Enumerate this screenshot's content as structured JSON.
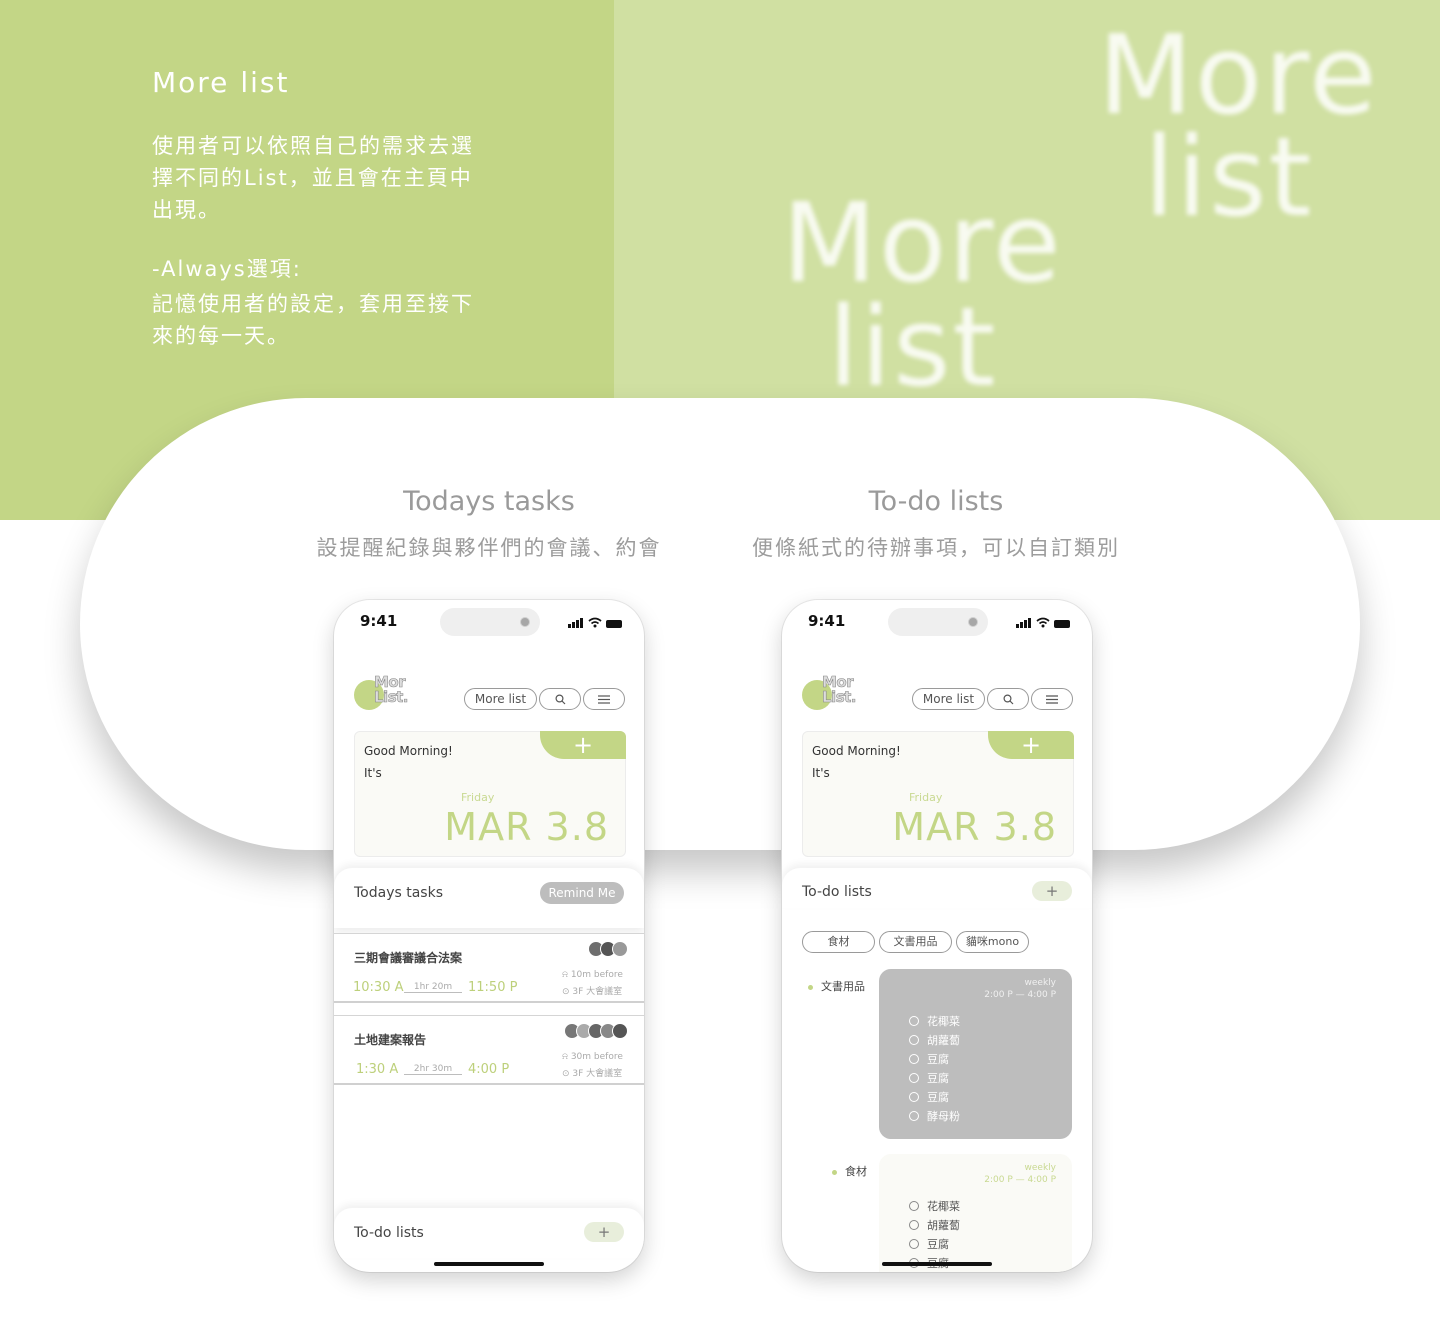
{
  "intro": {
    "title": "More list",
    "line1": "使用者可以依照自己的需求去選擇不同的List，並且會在主頁中出現。",
    "line2": "-Always選項:",
    "line3": "記憶使用者的設定，套用至接下來的每一天。",
    "watermark_a": "More",
    "watermark_b": "list"
  },
  "columns": [
    {
      "title": "Todays tasks",
      "subtitle": "設提醒紀錄與夥伴們的會議、約會"
    },
    {
      "title": "To-do lists",
      "subtitle": "便條紙式的待辦事項，可以自訂類別"
    }
  ],
  "colors": {
    "accent": "#c3d686",
    "accent_light": "#d0e0a2",
    "gray_card": "#bdbdbd"
  },
  "phone": {
    "time": "9:41",
    "logo_line1": "Mor",
    "logo_line2": "List.",
    "more_list_btn": "More list",
    "search_icon": "search-icon",
    "menu_icon": "menu-icon",
    "add_symbol": "+",
    "greeting": "Good Morning!",
    "its": "It's",
    "weekday": "Friday",
    "date": "MAR 3.8"
  },
  "phone1": {
    "section_title": "Todays tasks",
    "remind_btn": "Remind Me",
    "tasks": [
      {
        "name": "三期會議審議合法案",
        "start": "10:30 A",
        "duration": "1hr 20m",
        "end": "11:50 P",
        "remind": "10m before",
        "location": "3F 大會議室",
        "avatars": 3
      },
      {
        "name": "土地建案報告",
        "start": "1:30 A",
        "duration": "2hr 30m",
        "end": "4:00 P",
        "remind": "30m before",
        "location": "3F 大會議室",
        "avatars": 5
      }
    ],
    "bottom_title": "To-do lists",
    "bottom_add": "+"
  },
  "phone2": {
    "section_title": "To-do lists",
    "add_btn": "+",
    "categories": [
      "食材",
      "文書用品",
      "貓咪mono"
    ],
    "lists": [
      {
        "label": "文書用品",
        "freq": "weekly",
        "time": "2:00 P — 4:00 P",
        "items": [
          "花椰菜",
          "胡蘿蔔",
          "豆腐",
          "豆腐",
          "豆腐",
          "酵母粉"
        ]
      },
      {
        "label": "食材",
        "freq": "weekly",
        "time": "2:00 P — 4:00 P",
        "items": [
          "花椰菜",
          "胡蘿蔔",
          "豆腐",
          "豆腐"
        ]
      }
    ]
  }
}
